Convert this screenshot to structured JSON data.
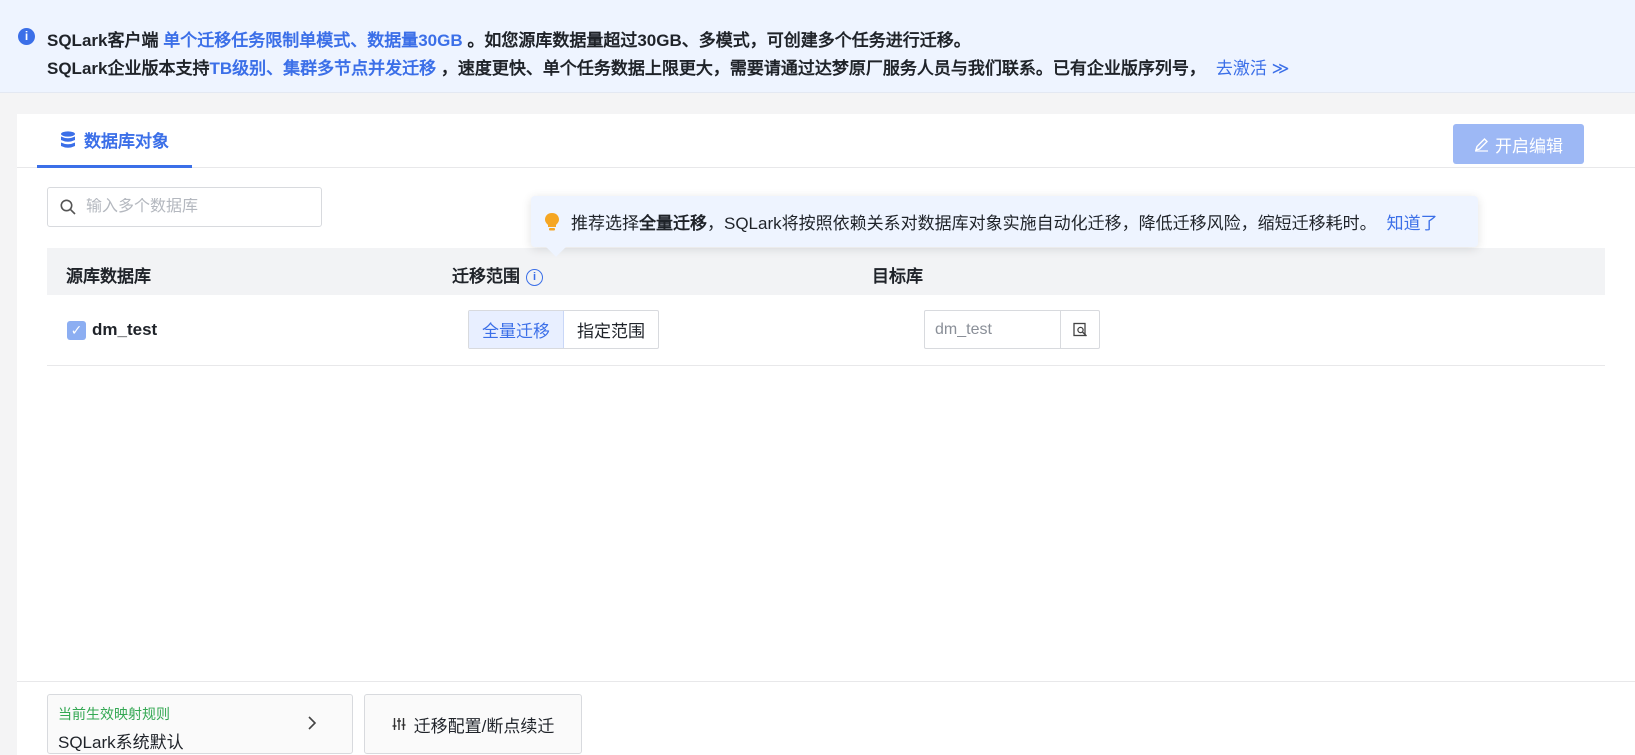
{
  "notice": {
    "line1": {
      "prefix": "SQLark客户端 ",
      "highlight1": "单个迁移任务限制单模式、数据量30GB",
      "suffix": " 。如您源库数据量超过30GB、多模式，可创建多个任务进行迁移。"
    },
    "line2": {
      "prefix": "SQLark企业版本支持",
      "highlight1": "TB级别、集群多节点并发迁移",
      "suffix": " ，速度更快、单个任务数据上限更大，需要请通过达梦原厂服务人员与我们联系。已有企业版序列号，",
      "activate": "去激活 ≫"
    }
  },
  "tabs": [
    {
      "label": "数据库对象",
      "active": true
    }
  ],
  "toolbar": {
    "edit_label": "开启编辑"
  },
  "search": {
    "placeholder": "输入多个数据库",
    "value": ""
  },
  "table": {
    "headers": [
      "源库数据库",
      "迁移范围",
      "目标库"
    ],
    "rows": [
      {
        "checked": true,
        "source": "dm_test",
        "range_options": [
          "全量迁移",
          "指定范围"
        ],
        "range_selected": "全量迁移",
        "target": "dm_test"
      }
    ]
  },
  "tooltip": {
    "pre": "推荐选择",
    "bold": "全量迁移",
    "post": "，SQLark将按照依赖关系对数据库对象实施自动化迁移，降低迁移风险，缩短迁移耗时。",
    "ok": "知道了"
  },
  "footer": {
    "rule_label": "当前生效映射规则",
    "rule_value": "SQLark系统默认",
    "config_label": "迁移配置/断点续迁"
  },
  "colors": {
    "accent": "#3b6fe8",
    "notice_bg": "#eef4ff",
    "rule_label": "#34a853",
    "tip_icon": "#f5a623"
  }
}
